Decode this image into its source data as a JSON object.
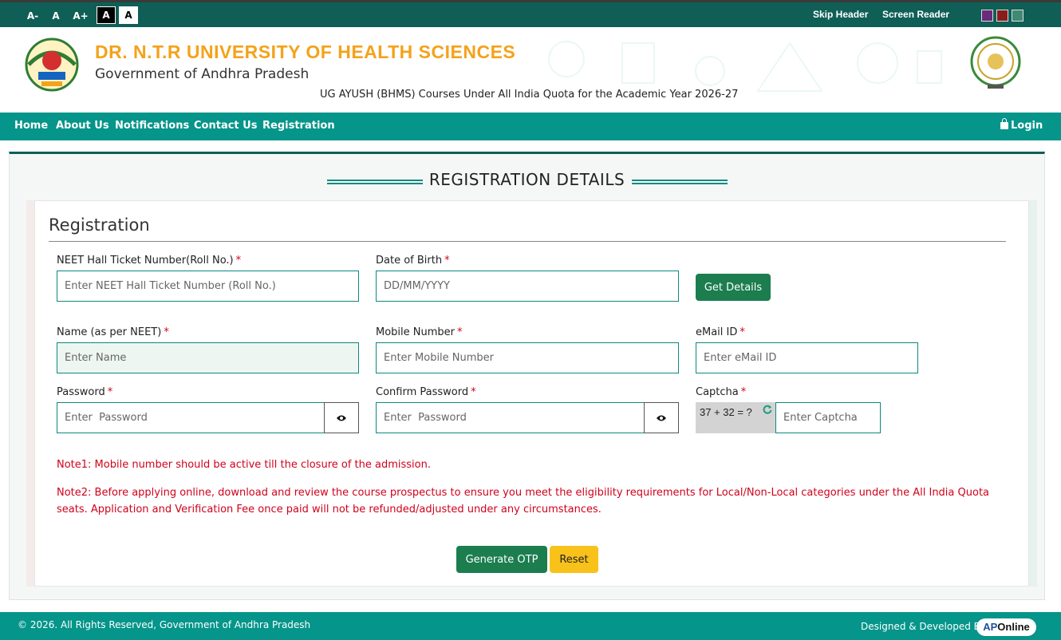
{
  "topbar": {
    "font_decrease": "A-",
    "font_normal": "A",
    "font_increase": "A+",
    "contrast_dark": "A",
    "contrast_light": "A",
    "skip_header": "Skip Header",
    "screen_reader": "Screen Reader",
    "theme_colors": [
      "#6b2a7a",
      "#8a1c1c",
      "#3e8a74"
    ]
  },
  "header": {
    "university": "DR. N.T.R UNIVERSITY OF HEALTH SCIENCES",
    "government": "Government of Andhra Pradesh",
    "course_line": "UG AYUSH (BHMS) Courses Under All India Quota for the Academic Year 2026-27",
    "left_logo_icon": "university-emblem",
    "right_logo_icon": "ap-state-emblem"
  },
  "nav": {
    "items": [
      "Home",
      "About Us",
      "Notifications",
      "Contact Us",
      "Registration"
    ],
    "login": "Login"
  },
  "page": {
    "section_heading": "REGISTRATION DETAILS",
    "form_title": "Registration"
  },
  "form": {
    "neet": {
      "label": "NEET Hall Ticket Number(Roll No.)",
      "placeholder": "Enter NEET Hall Ticket Number (Roll No.)"
    },
    "dob": {
      "label": "Date of Birth",
      "placeholder": "DD/MM/YYYY"
    },
    "get_details": "Get Details",
    "name": {
      "label": "Name (as per NEET)",
      "placeholder": "Enter Name"
    },
    "mobile": {
      "label": "Mobile Number",
      "placeholder": "Enter Mobile Number"
    },
    "email": {
      "label": "eMail ID",
      "placeholder": "Enter eMail ID"
    },
    "password": {
      "label": "Password",
      "placeholder": "Enter  Password"
    },
    "confirm_password": {
      "label": "Confirm Password",
      "placeholder": "Enter  Password"
    },
    "captcha": {
      "label": "Captcha",
      "question": "37 + 32 = ?",
      "placeholder": "Enter Captcha"
    },
    "required_mark": "*",
    "note1": "Note1: Mobile number should be active till the closure of the admission.",
    "note2": "Note2: Before applying online, download and review the course prospectus to ensure you meet the eligibility requirements for Local/Non-Local categories under the All India Quota seats. Application and Verification Fee once paid will not be refunded/adjusted under any circumstances.",
    "generate_otp": "Generate OTP",
    "reset": "Reset"
  },
  "footer": {
    "copyright": "© 2026. All Rights Reserved, Government of Andhra Pradesh",
    "designed_by": "Designed & Developed By",
    "brand_ap": "AP",
    "brand_online": "Online"
  },
  "colors": {
    "primary_teal": "#05958a",
    "dark_teal": "#0f5f56",
    "title_orange": "#f4a21b",
    "button_green": "#1c7d4f",
    "button_yellow": "#f8c21b",
    "note_red": "#d0021b"
  }
}
